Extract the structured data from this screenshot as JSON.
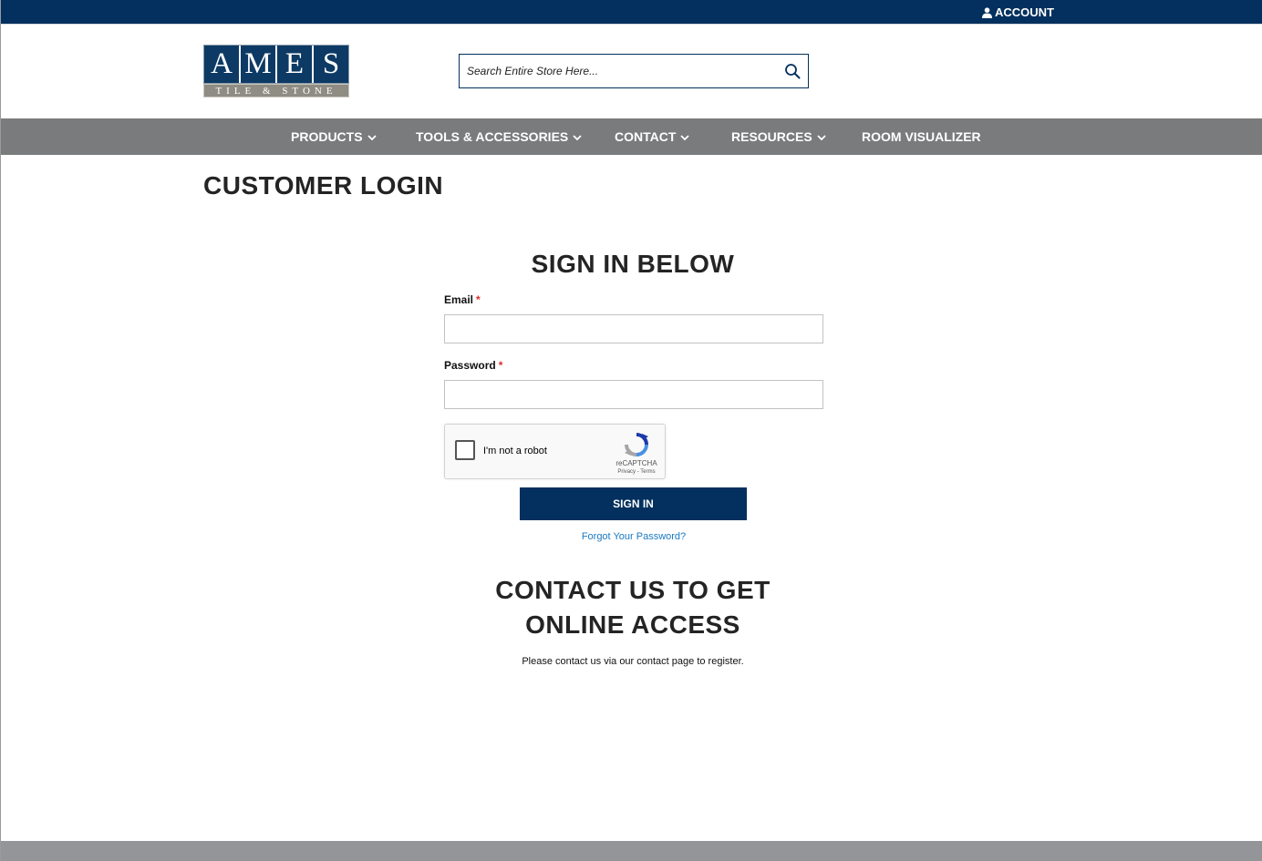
{
  "topbar": {
    "account_label": "ACCOUNT",
    "account_icon": "user-icon"
  },
  "logo": {
    "letters": [
      "A",
      "M",
      "E",
      "S"
    ],
    "tagline": "TILE & STONE"
  },
  "search": {
    "placeholder": "Search Entire Store Here...",
    "value": "",
    "icon": "search-icon"
  },
  "nav": {
    "items": [
      {
        "label": "PRODUCTS",
        "dropdown": true
      },
      {
        "label": "TOOLS & ACCESSORIES",
        "dropdown": true
      },
      {
        "label": "CONTACT",
        "dropdown": true
      },
      {
        "label": "RESOURCES",
        "dropdown": true
      },
      {
        "label": "ROOM VISUALIZER",
        "dropdown": false
      }
    ]
  },
  "main": {
    "page_title": "CUSTOMER LOGIN",
    "signin_heading": "SIGN IN BELOW",
    "email_label": "Email",
    "email_value": "",
    "password_label": "Password",
    "password_value": "",
    "required_mark": "*",
    "captcha": {
      "label": "I'm not a robot",
      "brand": "reCAPTCHA",
      "links": "Privacy - Terms"
    },
    "signin_button": "SIGN IN",
    "forgot_link": "Forgot Your Password?",
    "contact_heading_line1": "CONTACT US TO GET",
    "contact_heading_line2": "ONLINE ACCESS",
    "contact_text": "Please contact us via our contact page to register."
  },
  "colors": {
    "navy": "#03305e",
    "nav_gray": "#797b7d",
    "link_blue": "#1979c3",
    "required_red": "#e02b27"
  }
}
